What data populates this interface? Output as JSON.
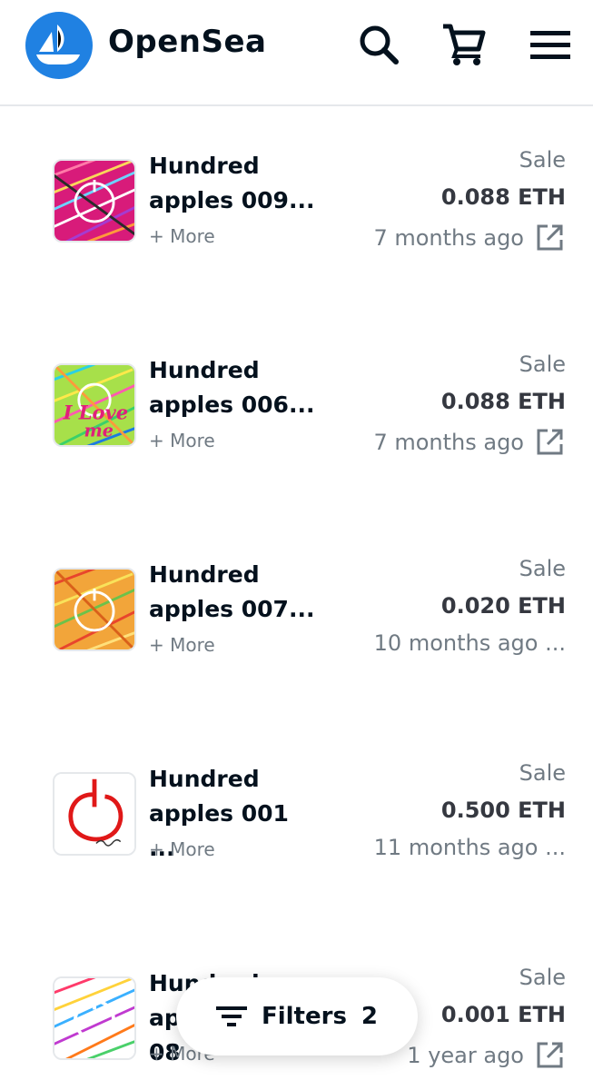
{
  "header": {
    "brand": "OpenSea",
    "icons": [
      "opensea-logo",
      "search-icon",
      "cart-icon",
      "menu-icon"
    ]
  },
  "items": [
    {
      "name": "Hundred\napples 009...",
      "more": "+ More",
      "event": "Sale",
      "price": "0.088 ETH",
      "time": "7 months ago",
      "has_link": true
    },
    {
      "name": "Hundred\napples 006...",
      "more": "+ More",
      "event": "Sale",
      "price": "0.088 ETH",
      "time": "7 months ago",
      "has_link": true
    },
    {
      "name": "Hundred\napples 007...",
      "more": "+ More",
      "event": "Sale",
      "price": "0.020 ETH",
      "time": "10 months ago ...",
      "has_link": false
    },
    {
      "name": "Hundred\napples 001    ...",
      "more": "+ More",
      "event": "Sale",
      "price": "0.500 ETH",
      "time": "11 months ago ...",
      "has_link": false
    },
    {
      "name": "Hundred apples\n08",
      "more": "+ More",
      "event": "Sale",
      "price": "0.001 ETH",
      "time": "1 year ago",
      "has_link": true
    }
  ],
  "filters": {
    "label": "Filters",
    "count": "2"
  },
  "colors": {
    "brand_blue": "#2081e2",
    "text": "#04111d",
    "muted": "#707a83"
  }
}
